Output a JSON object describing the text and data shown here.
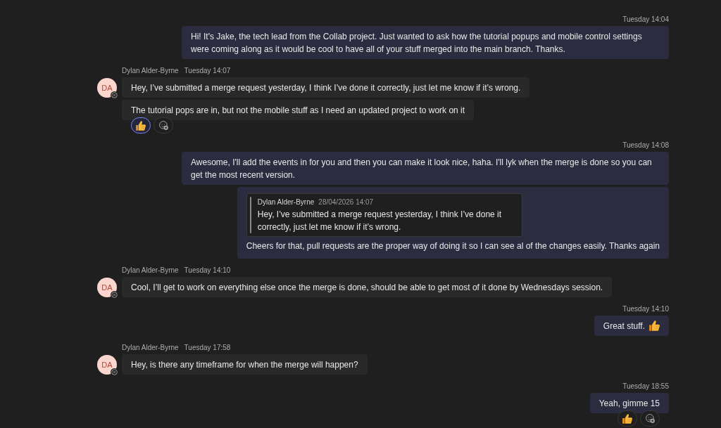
{
  "messages": [
    {
      "kind": "outgoing",
      "time": "Tuesday 14:04",
      "bubbles": [
        {
          "text": "Hi! It's Jake, the tech lead from the Collab project. Just wanted to ask how the tutorial popups and mobile control settings were coming along as it would be cool to have all of your stuff merged into the main branch. Thanks."
        }
      ]
    },
    {
      "kind": "incoming",
      "sender": "Dylan Alder-Byrne",
      "initials": "DA",
      "offline": true,
      "time": "Tuesday 14:07",
      "bubbles": [
        {
          "text": "Hey, I’ve submitted a merge request yesterday, I think I’ve done it correctly, just let me know if it’s wrong."
        },
        {
          "text": "The tutorial pops are in, but not the mobile stuff as I need an updated project to work on it",
          "reactions": [
            {
              "selected": true
            }
          ]
        }
      ]
    },
    {
      "kind": "outgoing",
      "time": "Tuesday 14:08",
      "bubbles": [
        {
          "text": "Awesome, I'll add the events in for you and then you can make it look nice, haha. I'll lyk when the merge is done so you can get the most recent version."
        },
        {
          "quote": {
            "sender": "Dylan Alder-Byrne",
            "time": "28/04/2026 14:07",
            "text": "Hey, I’ve submitted a merge request yesterday, I think I’ve done it correctly, just let me know if it’s wrong."
          },
          "text": "Cheers for that, pull requests are the proper way of doing it so I can see al of the changes easily. Thanks again"
        }
      ]
    },
    {
      "kind": "incoming",
      "sender": "Dylan Alder-Byrne",
      "initials": "DA",
      "offline": true,
      "time": "Tuesday 14:10",
      "bubbles": [
        {
          "text": "Cool, I’ll get to work on everything else once the merge is done, should be able to get most of it done by Wednesdays session."
        }
      ]
    },
    {
      "kind": "outgoing",
      "time": "Tuesday 14:10",
      "bubbles": [
        {
          "text": "Great stuff.",
          "emoji_after": true
        }
      ]
    },
    {
      "kind": "incoming",
      "sender": "Dylan Alder-Byrne",
      "initials": "DA",
      "offline": true,
      "time": "Tuesday 17:58",
      "bubbles": [
        {
          "text": "Hey, is there any timeframe for when the merge will happen?"
        }
      ]
    },
    {
      "kind": "outgoing",
      "time": "Tuesday 18:55",
      "bubbles": [
        {
          "text": "Yeah, gimme 15",
          "reactions": [
            {
              "selected": false
            }
          ]
        }
      ]
    }
  ]
}
